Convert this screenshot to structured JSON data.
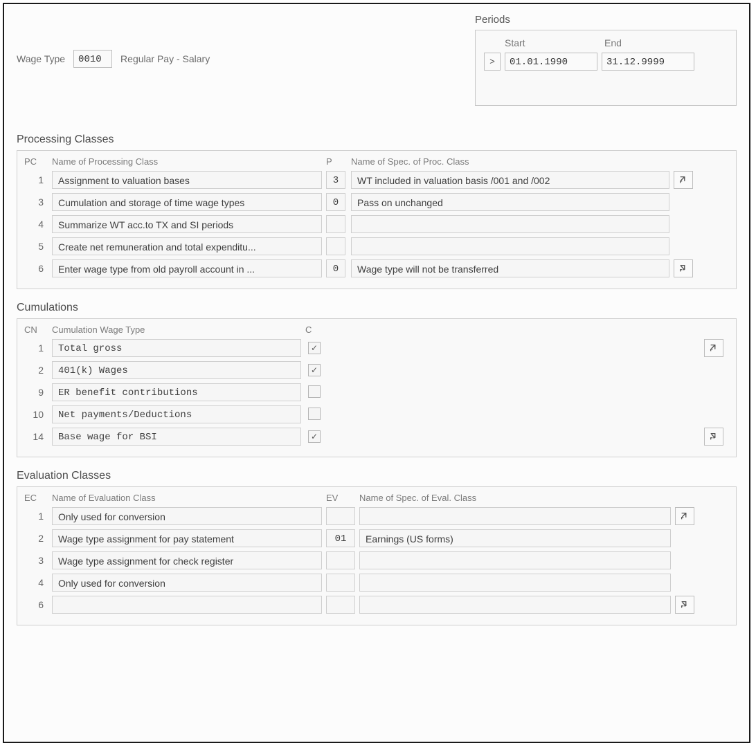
{
  "wage_type": {
    "label": "Wage Type",
    "code": "0010",
    "name": "Regular Pay - Salary"
  },
  "periods": {
    "title": "Periods",
    "start_label": "Start",
    "end_label": "End",
    "selector": ">",
    "start": "01.01.1990",
    "end": "31.12.9999"
  },
  "processing_classes": {
    "title": "Processing Classes",
    "headers": {
      "pc": "PC",
      "name": "Name of Processing Class",
      "p": "P",
      "spec": "Name of Spec. of Proc. Class"
    },
    "rows": [
      {
        "pc": "1",
        "name": "Assignment to valuation bases",
        "p": "3",
        "spec": "WT included in valuation basis /001 and /002"
      },
      {
        "pc": "3",
        "name": "Cumulation and storage of time wage types",
        "p": "0",
        "spec": "Pass on unchanged"
      },
      {
        "pc": "4",
        "name": "Summarize WT acc.to TX and SI periods",
        "p": "",
        "spec": ""
      },
      {
        "pc": "5",
        "name": "Create net remuneration and total expenditu...",
        "p": "",
        "spec": ""
      },
      {
        "pc": "6",
        "name": "Enter wage type from old payroll account in ...",
        "p": "0",
        "spec": "Wage type will not be transferred"
      }
    ]
  },
  "cumulations": {
    "title": "Cumulations",
    "headers": {
      "cn": "CN",
      "name": "Cumulation Wage Type",
      "c": "C"
    },
    "rows": [
      {
        "cn": "1",
        "name": "Total gross",
        "checked": true
      },
      {
        "cn": "2",
        "name": "401(k) Wages",
        "checked": true
      },
      {
        "cn": "9",
        "name": "ER benefit contributions",
        "checked": false
      },
      {
        "cn": "10",
        "name": "Net payments/Deductions",
        "checked": false
      },
      {
        "cn": "14",
        "name": "Base wage for BSI",
        "checked": true
      }
    ]
  },
  "evaluation_classes": {
    "title": "Evaluation Classes",
    "headers": {
      "ec": "EC",
      "name": "Name of Evaluation Class",
      "ev": "EV",
      "spec": "Name of Spec. of Eval. Class"
    },
    "rows": [
      {
        "ec": "1",
        "name": "Only used for conversion",
        "ev": "",
        "spec": ""
      },
      {
        "ec": "2",
        "name": "Wage type assignment for pay statement",
        "ev": "01",
        "spec": "Earnings (US forms)"
      },
      {
        "ec": "3",
        "name": "Wage type assignment for check register",
        "ev": "",
        "spec": ""
      },
      {
        "ec": "4",
        "name": "Only used for conversion",
        "ev": "",
        "spec": ""
      },
      {
        "ec": "6",
        "name": "",
        "ev": "",
        "spec": ""
      }
    ]
  }
}
